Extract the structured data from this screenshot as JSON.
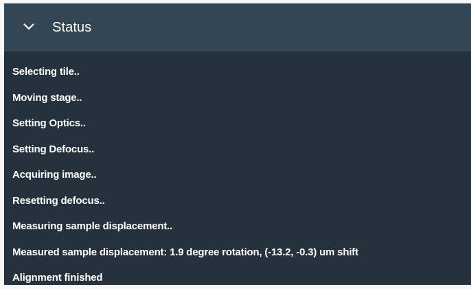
{
  "panel": {
    "title": "Status",
    "toggle_icon": "chevron-down-icon",
    "expanded": true
  },
  "colors": {
    "header_bg": "#344553",
    "body_bg": "#25323d",
    "text": "#ffffff"
  },
  "log": [
    "Selecting tile..",
    "Moving stage..",
    "Setting Optics..",
    "Setting Defocus..",
    "Acquiring image..",
    "Resetting defocus..",
    "Measuring sample displacement..",
    "Measured sample displacement: 1.9 degree rotation, (-13.2, -0.3) um shift",
    "Alignment finished"
  ]
}
